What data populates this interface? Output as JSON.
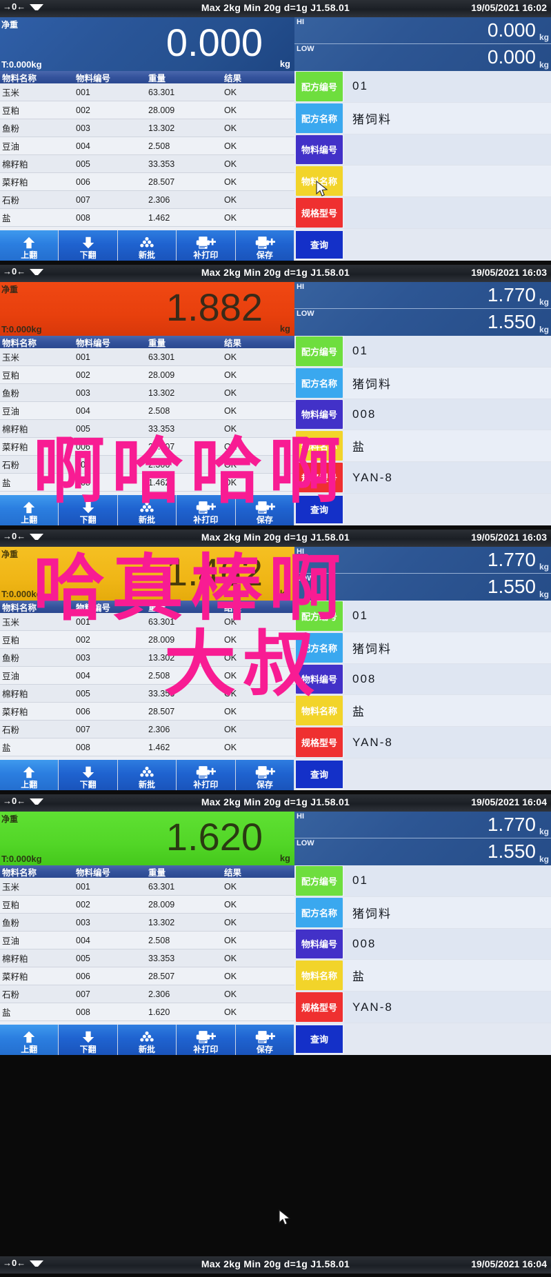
{
  "device": {
    "spec_text": "Max 2kg  Min 20g  d=1g    J1.58.01",
    "zero_icon": "zero-indicator-icon",
    "stable_icon": "stability-icon",
    "unit": "kg",
    "net_label": "净重",
    "tare_label": "T:0.000kg",
    "hi_label": "HI",
    "low_label": "LOW"
  },
  "table": {
    "headers": [
      "物料名称",
      "物料编号",
      "重量",
      "结果"
    ],
    "rows": [
      {
        "name": "玉米",
        "code": "001",
        "weight": "63.301",
        "result": "OK"
      },
      {
        "name": "豆粕",
        "code": "002",
        "weight": "28.009",
        "result": "OK"
      },
      {
        "name": "鱼粉",
        "code": "003",
        "weight": "13.302",
        "result": "OK"
      },
      {
        "name": "豆油",
        "code": "004",
        "weight": "2.508",
        "result": "OK"
      },
      {
        "name": "棉籽粕",
        "code": "005",
        "weight": "33.353",
        "result": "OK"
      },
      {
        "name": "菜籽粕",
        "code": "006",
        "weight": "28.507",
        "result": "OK"
      },
      {
        "name": "石粉",
        "code": "007",
        "weight": "2.306",
        "result": "OK"
      },
      {
        "name": "盐",
        "code": "008",
        "weight": "1.462",
        "result": "OK"
      }
    ],
    "rows_last": [
      {
        "name": "玉米",
        "code": "001",
        "weight": "63.301",
        "result": "OK"
      },
      {
        "name": "豆粕",
        "code": "002",
        "weight": "28.009",
        "result": "OK"
      },
      {
        "name": "鱼粉",
        "code": "003",
        "weight": "13.302",
        "result": "OK"
      },
      {
        "name": "豆油",
        "code": "004",
        "weight": "2.508",
        "result": "OK"
      },
      {
        "name": "棉籽粕",
        "code": "005",
        "weight": "33.353",
        "result": "OK"
      },
      {
        "name": "菜籽粕",
        "code": "006",
        "weight": "28.507",
        "result": "OK"
      },
      {
        "name": "石粉",
        "code": "007",
        "weight": "2.306",
        "result": "OK"
      },
      {
        "name": "盐",
        "code": "008",
        "weight": "1.620",
        "result": "OK"
      }
    ]
  },
  "toolbar": {
    "buttons": [
      {
        "label": "上翻",
        "icon": "arrow-up-icon"
      },
      {
        "label": "下翻",
        "icon": "arrow-down-icon"
      },
      {
        "label": "新批",
        "icon": "new-batch-icon"
      },
      {
        "label": "补打印",
        "icon": "reprint-icon"
      },
      {
        "label": "保存",
        "icon": "save-print-icon"
      }
    ]
  },
  "keypad": {
    "query_label": "查询",
    "keys": [
      {
        "label": "配方编号",
        "color": "#6ede3e"
      },
      {
        "label": "配方名称",
        "color": "#3aa8ef"
      },
      {
        "label": "物料编号",
        "color": "#4231c8"
      },
      {
        "label": "物料名称",
        "color": "#f2d42a"
      },
      {
        "label": "规格型号",
        "color": "#ef3030"
      }
    ]
  },
  "panels": [
    {
      "time": "16:02",
      "date": "19/05/2021",
      "weight": "0.000",
      "weight_color": "blue",
      "hi": "0.000",
      "low": "0.000",
      "values": [
        "01",
        "猪饲料",
        "",
        "",
        ""
      ],
      "rows_key": "rows"
    },
    {
      "time": "16:03",
      "date": "19/05/2021",
      "weight": "1.882",
      "weight_color": "red",
      "hi": "1.770",
      "low": "1.550",
      "values": [
        "01",
        "猪饲料",
        "008",
        "盐",
        "YAN-8"
      ],
      "rows_key": "rows"
    },
    {
      "time": "16:03",
      "date": "19/05/2021",
      "weight": "1.462",
      "weight_color": "yellow",
      "hi": "1.770",
      "low": "1.550",
      "values": [
        "01",
        "猪饲料",
        "008",
        "盐",
        "YAN-8"
      ],
      "rows_key": "rows"
    },
    {
      "time": "16:04",
      "date": "19/05/2021",
      "weight": "1.620",
      "weight_color": "green",
      "hi": "1.770",
      "low": "1.550",
      "values": [
        "01",
        "猪饲料",
        "008",
        "盐",
        "YAN-8"
      ],
      "rows_key": "rows_last"
    }
  ],
  "bottom_strip": {
    "spec_text": "Max 2kg  Min 20g  d=1g    J1.58.01",
    "date": "19/05/2021",
    "time": "16:04"
  },
  "overlay": {
    "color": "#f81c93",
    "line1": "啊哈哈啊",
    "line2": "哈真棒啊",
    "line3": "大叔"
  }
}
